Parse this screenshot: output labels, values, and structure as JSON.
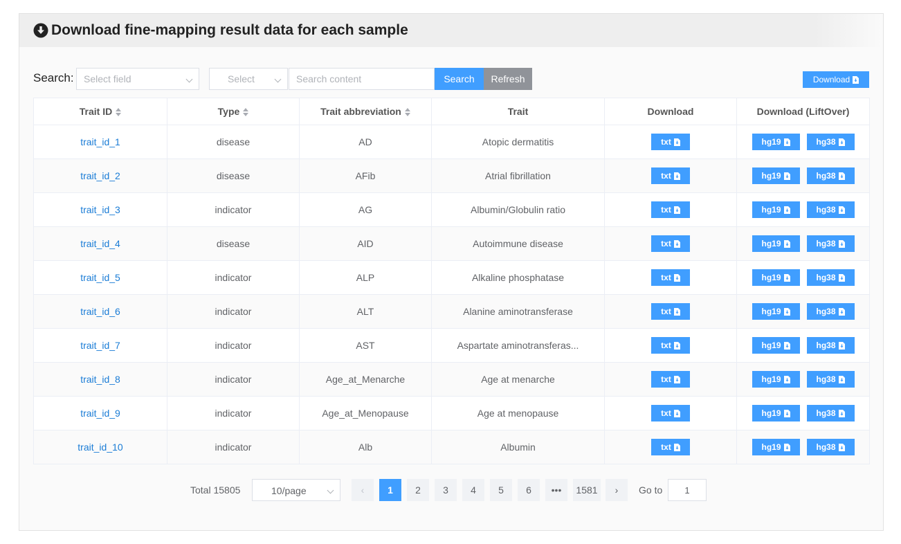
{
  "header": {
    "title": "Download fine-mapping result data for each sample",
    "icon": "circle-download-icon"
  },
  "search": {
    "label": "Search:",
    "field_placeholder": "Select field",
    "op_placeholder": "Select",
    "content_placeholder": "Search content",
    "search_label": "Search",
    "refresh_label": "Refresh",
    "download_label": "Download"
  },
  "colors": {
    "primary": "#409eff",
    "refresh": "#909399",
    "link": "#1a7cd6"
  },
  "table": {
    "columns": [
      "Trait ID",
      "Type",
      "Trait abbreviation",
      "Trait",
      "Download",
      "Download (LiftOver)"
    ],
    "buttons": {
      "txt": "txt",
      "hg19": "hg19",
      "hg38": "hg38"
    },
    "rows": [
      {
        "id": "trait_id_1",
        "type": "disease",
        "abbr": "AD",
        "trait": "Atopic dermatitis"
      },
      {
        "id": "trait_id_2",
        "type": "disease",
        "abbr": "AFib",
        "trait": "Atrial fibrillation"
      },
      {
        "id": "trait_id_3",
        "type": "indicator",
        "abbr": "AG",
        "trait": "Albumin/Globulin ratio"
      },
      {
        "id": "trait_id_4",
        "type": "disease",
        "abbr": "AID",
        "trait": "Autoimmune disease"
      },
      {
        "id": "trait_id_5",
        "type": "indicator",
        "abbr": "ALP",
        "trait": "Alkaline phosphatase"
      },
      {
        "id": "trait_id_6",
        "type": "indicator",
        "abbr": "ALT",
        "trait": "Alanine aminotransferase"
      },
      {
        "id": "trait_id_7",
        "type": "indicator",
        "abbr": "AST",
        "trait": "Aspartate aminotransferas..."
      },
      {
        "id": "trait_id_8",
        "type": "indicator",
        "abbr": "Age_at_Menarche",
        "trait": "Age at menarche"
      },
      {
        "id": "trait_id_9",
        "type": "indicator",
        "abbr": "Age_at_Menopause",
        "trait": "Age at menopause"
      },
      {
        "id": "trait_id_10",
        "type": "indicator",
        "abbr": "Alb",
        "trait": "Albumin"
      }
    ]
  },
  "pagination": {
    "total": "Total 15805",
    "page_size": "10/page",
    "prev": "‹",
    "next": "›",
    "pages": [
      "1",
      "2",
      "3",
      "4",
      "5",
      "6",
      "•••",
      "1581"
    ],
    "current": "1",
    "goto_label": "Go to",
    "goto_value": "1"
  }
}
